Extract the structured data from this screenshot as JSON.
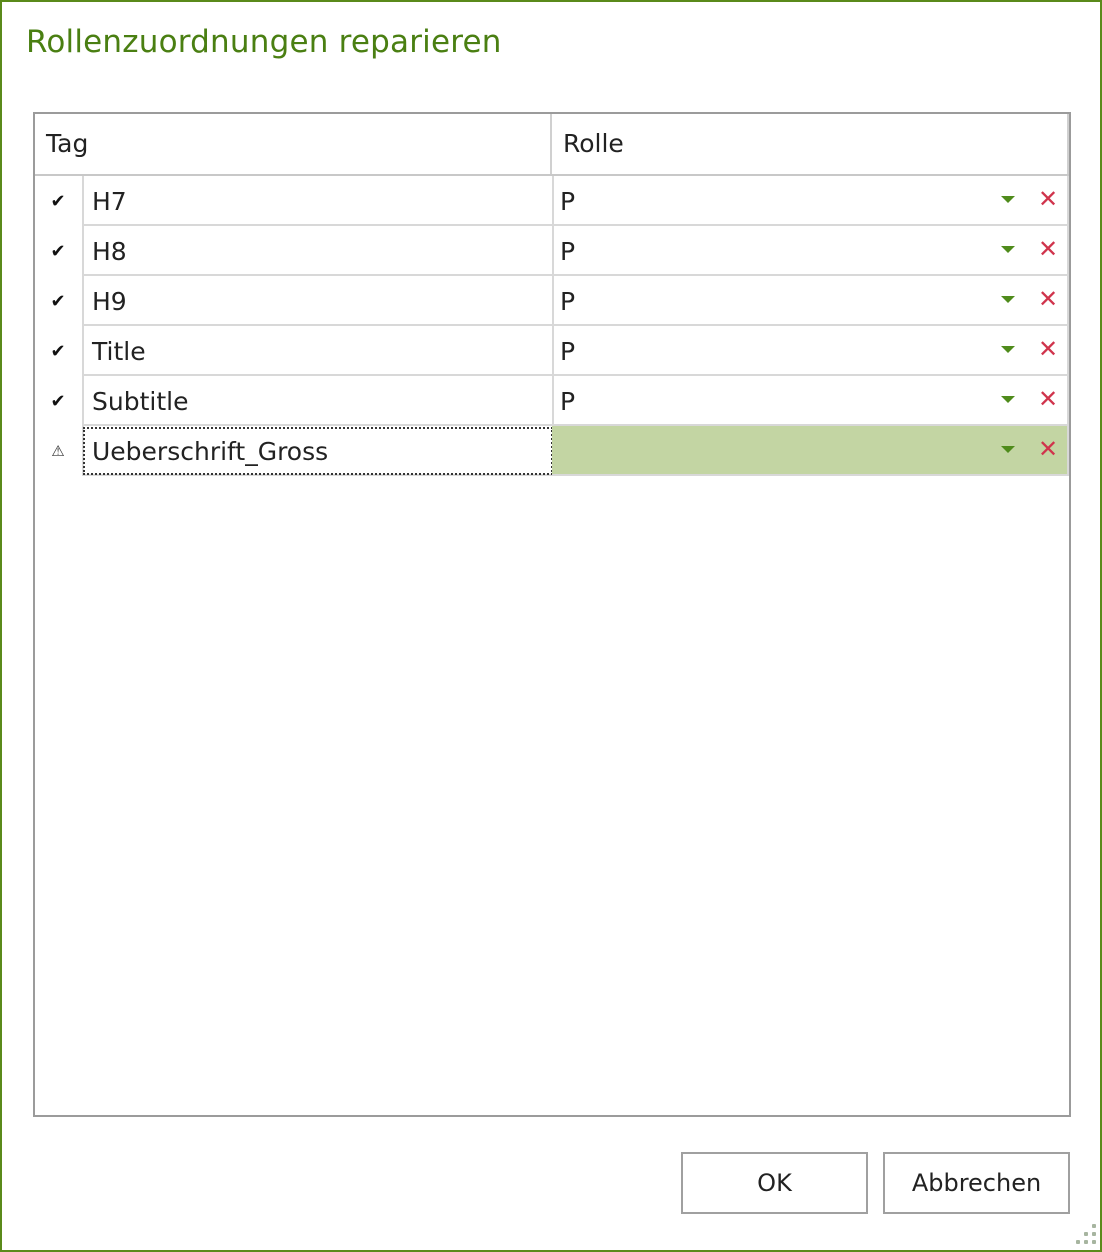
{
  "dialog": {
    "title": "Rollenzuordnungen reparieren",
    "accent_color": "#4a7f12",
    "selection_color": "#c3d5a3",
    "delete_color": "#d0344c"
  },
  "grid": {
    "columns": {
      "tag": "Tag",
      "rolle": "Rolle"
    },
    "rows": [
      {
        "status": "ok",
        "status_icon": "✔",
        "tag": "H7",
        "rolle": "P"
      },
      {
        "status": "ok",
        "status_icon": "✔",
        "tag": "H8",
        "rolle": "P"
      },
      {
        "status": "ok",
        "status_icon": "✔",
        "tag": "H9",
        "rolle": "P"
      },
      {
        "status": "ok",
        "status_icon": "✔",
        "tag": "Title",
        "rolle": "P"
      },
      {
        "status": "ok",
        "status_icon": "✔",
        "tag": "Subtitle",
        "rolle": "P"
      },
      {
        "status": "warning",
        "status_icon": "⚠",
        "tag": "Ueberschrift_Gross",
        "rolle": ""
      }
    ],
    "delete_icon": "✕"
  },
  "buttons": {
    "ok": "OK",
    "cancel": "Abbrechen"
  }
}
